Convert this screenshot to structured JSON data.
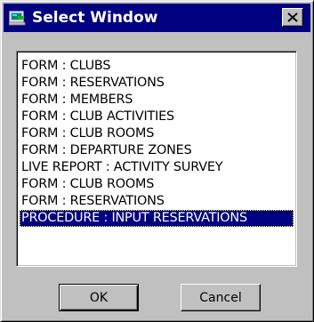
{
  "window": {
    "title": "Select Window",
    "title_icon": "window-app-icon",
    "close_icon": "close-icon"
  },
  "list": {
    "items": [
      "FORM : CLUBS",
      "FORM : RESERVATIONS",
      "FORM : MEMBERS",
      "FORM : CLUB ACTIVITIES",
      "FORM : CLUB ROOMS",
      "FORM : DEPARTURE ZONES",
      "LIVE REPORT : ACTIVITY SURVEY",
      "FORM : CLUB ROOMS",
      "FORM : RESERVATIONS",
      "PROCEDURE : INPUT RESERVATIONS"
    ],
    "selected_index": 9
  },
  "buttons": {
    "ok_label": "OK",
    "cancel_label": "Cancel"
  },
  "colors": {
    "titlebar": "#000080",
    "face": "#c0c0c0",
    "selection": "#000080"
  }
}
